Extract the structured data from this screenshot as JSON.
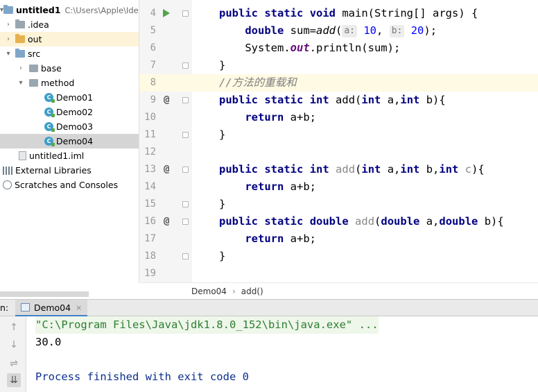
{
  "project_tree": {
    "root_name": "untitled1",
    "root_path": "C:\\Users\\Apple\\Idea",
    "items": [
      {
        "label": ".idea",
        "icon": "folder-icon"
      },
      {
        "label": "out",
        "icon": "folder-icon"
      },
      {
        "label": "src",
        "icon": "folder-icon"
      },
      {
        "label": "base",
        "icon": "package-icon"
      },
      {
        "label": "method",
        "icon": "package-icon"
      },
      {
        "label": "Demo01",
        "icon": "class-icon"
      },
      {
        "label": "Demo02",
        "icon": "class-icon"
      },
      {
        "label": "Demo03",
        "icon": "class-icon"
      },
      {
        "label": "Demo04",
        "icon": "class-icon"
      },
      {
        "label": "untitled1.iml",
        "icon": "file-icon"
      },
      {
        "label": "External Libraries",
        "icon": "libraries-icon"
      },
      {
        "label": "Scratches and Consoles",
        "icon": "scratch-icon"
      }
    ],
    "selected": "Demo04"
  },
  "editor": {
    "line_numbers": [
      "4",
      "5",
      "6",
      "7",
      "8",
      "9",
      "10",
      "11",
      "12",
      "13",
      "14",
      "15",
      "16",
      "17",
      "18",
      "19"
    ],
    "current_line": "8",
    "tokens": {
      "public": "public",
      "static": "static",
      "void": "void",
      "main_sig": " main(String[] args) {",
      "double": "double",
      "sum_assign": " sum=",
      "add_call": "add",
      "paren_open": "(",
      "hint_a": "a:",
      "val_10": "10",
      "comma": ", ",
      "hint_b": "b:",
      "val_20": "20",
      "close_stmt": ");",
      "system_out_prefix": "System.",
      "out_field": "out",
      "println_call": ".println(sum);",
      "brace_close": "}",
      "comment": "//方法的重载和",
      "int": "int",
      "add_name": "add",
      "add1_params": "(",
      "a_param": " a,",
      "b_param": " b){",
      "b_param_plain": " b,",
      "c_param": "c",
      "c_close": "){",
      "return": "return",
      "a_plus_b": " a+b;",
      "d_close": " b){"
    }
  },
  "breadcrumb": {
    "items": [
      "Demo04",
      "add()"
    ]
  },
  "run_panel": {
    "label": "n:",
    "tab_name": "Demo04",
    "tab_close": "×",
    "console_lines": [
      "\"C:\\Program Files\\Java\\jdk1.8.0_152\\bin\\java.exe\" ...",
      "30.0",
      "",
      "Process finished with exit code 0"
    ]
  }
}
